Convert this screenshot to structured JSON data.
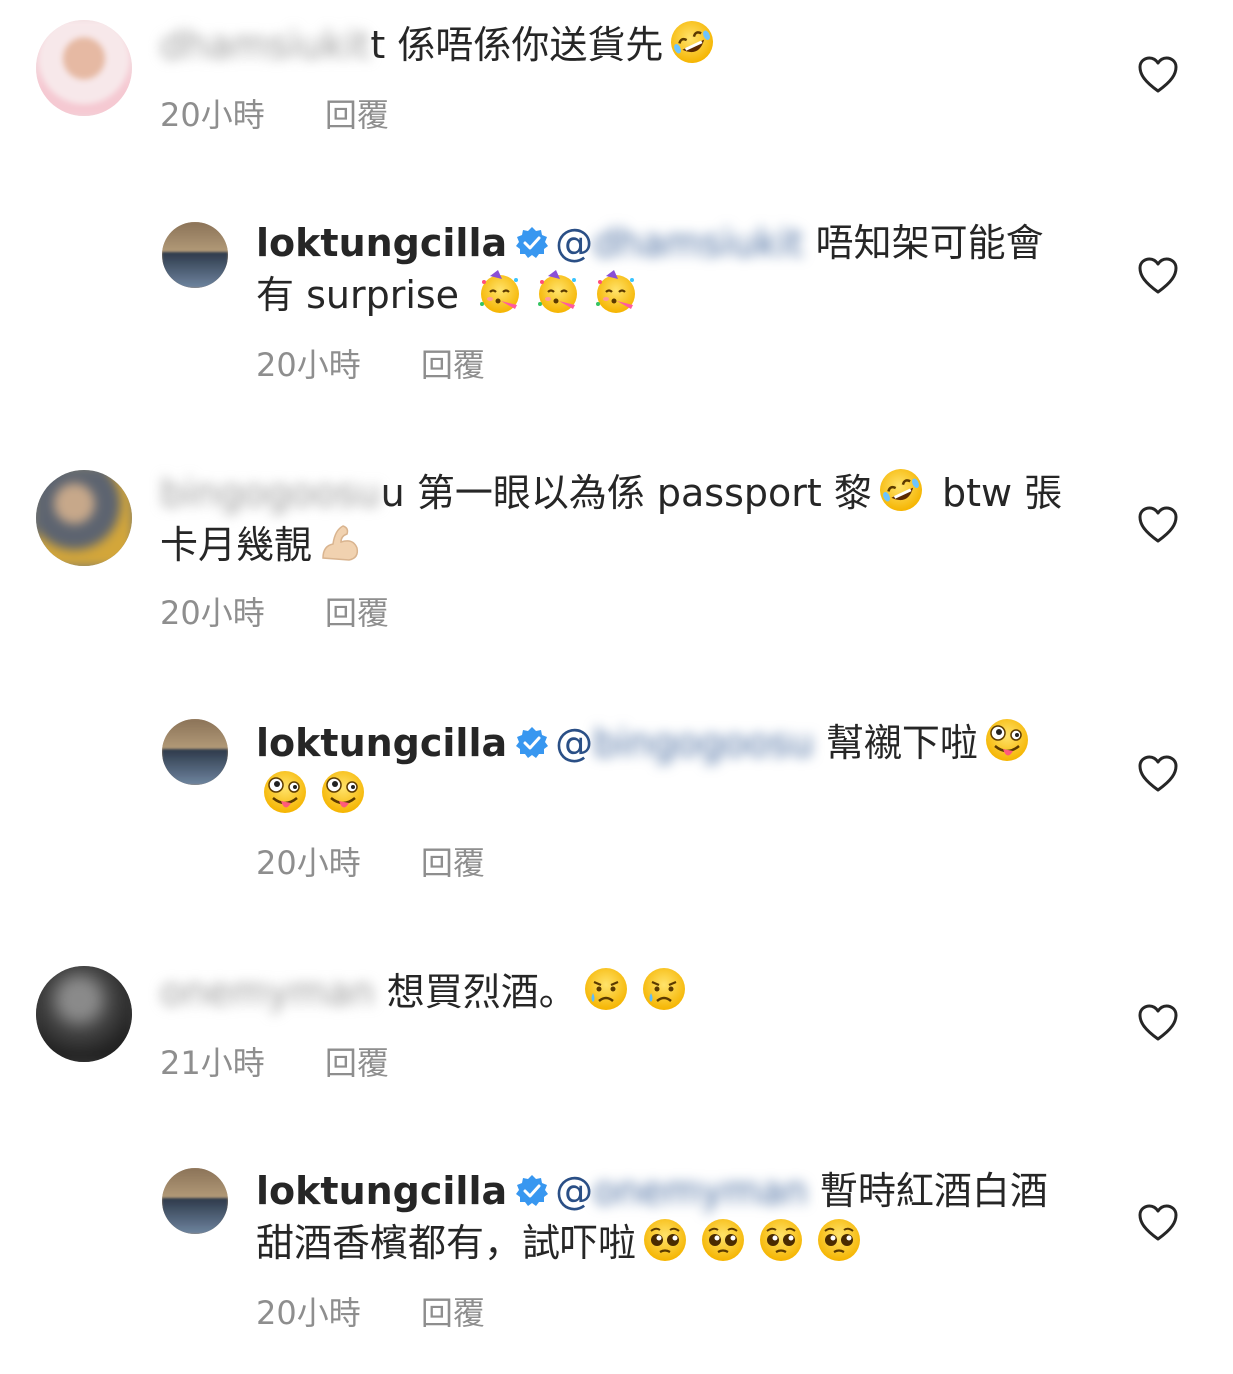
{
  "comments": [
    {
      "username_blurred": "dhamsiukit",
      "username_tail": "t",
      "text": " 係唔係你送貨先",
      "emojis": [
        "rofl"
      ],
      "time": "20小時",
      "reply_label": "回覆"
    },
    {
      "username": "loktungcilla",
      "mention_prefix": "@",
      "mention_blurred": "dhamsiukit",
      "text_line1": " 唔知架可能會",
      "text_line2": "有 surprise ",
      "emojis": [
        "party",
        "party",
        "party"
      ],
      "time": "20小時",
      "reply_label": "回覆"
    },
    {
      "username_blurred": "bingogoosu",
      "username_tail": "u",
      "text_line1": " 第一眼以為係 passport 黎",
      "text_line1b": " btw 張",
      "text_line2": "卡月幾靚",
      "emojis_line1": [
        "rofl"
      ],
      "emojis_line2": [
        "muscle"
      ],
      "time": "20小時",
      "reply_label": "回覆"
    },
    {
      "username": "loktungcilla",
      "mention_prefix": "@",
      "mention_blurred": "bingogoosu",
      "text": " 幫襯下啦",
      "emojis": [
        "zany",
        "zany",
        "zany"
      ],
      "time": "20小時",
      "reply_label": "回覆"
    },
    {
      "username_blurred": "onemyman",
      "text": " 想買烈酒。",
      "emojis": [
        "sad",
        "sad"
      ],
      "time": "21小時",
      "reply_label": "回覆"
    },
    {
      "username": "loktungcilla",
      "mention_prefix": "@",
      "mention_blurred": "onemyman",
      "text_line1": " 暫時紅酒白酒",
      "text_line2": "甜酒香檳都有，試吓啦",
      "emojis": [
        "pleading",
        "pleading",
        "pleading",
        "pleading"
      ],
      "time": "20小時",
      "reply_label": "回覆"
    }
  ],
  "colors": {
    "meta": "#8e8e8e",
    "text": "#262626",
    "verified": "#3897f0"
  }
}
